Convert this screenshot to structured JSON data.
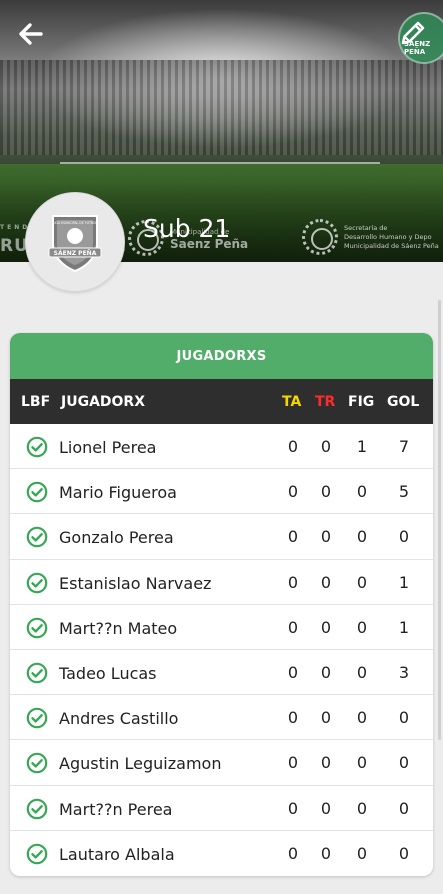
{
  "header": {
    "back_icon": "arrow-left-icon",
    "edit_icon": "pencil-icon",
    "team_name": "Sub 21",
    "banner_sponsors": {
      "left_small": "TENDE",
      "left_main": "RUNC CIPOL",
      "mid_line1": "Municipalidad de",
      "mid_line2": "Saenz Peña",
      "right_line1": "Secretaría de",
      "right_line2": "Desarrollo Humano y Depo",
      "right_line3": "Municipalidad de Sáenz Peña"
    },
    "corner_logo_text": "SAENZ PEÑA",
    "avatar_text_top": "LIGA MUNICIPAL DE FUTBOL",
    "avatar_text": "SÁENZ PEÑA"
  },
  "card": {
    "title": "JUGADORXS",
    "columns": {
      "lbf": "LBF",
      "player": "JUGADORX",
      "ta": "TA",
      "tr": "TR",
      "fig": "FIG",
      "gol": "GOL"
    },
    "rows": [
      {
        "name": "Lionel Perea",
        "ta": "0",
        "tr": "0",
        "fig": "1",
        "gol": "7"
      },
      {
        "name": "Mario Figueroa",
        "ta": "0",
        "tr": "0",
        "fig": "0",
        "gol": "5"
      },
      {
        "name": "Gonzalo Perea",
        "ta": "0",
        "tr": "0",
        "fig": "0",
        "gol": "0"
      },
      {
        "name": "Estanislao Narvaez",
        "ta": "0",
        "tr": "0",
        "fig": "0",
        "gol": "1"
      },
      {
        "name": "Mart??n Mateo",
        "ta": "0",
        "tr": "0",
        "fig": "0",
        "gol": "1"
      },
      {
        "name": "Tadeo Lucas",
        "ta": "0",
        "tr": "0",
        "fig": "0",
        "gol": "3"
      },
      {
        "name": "Andres Castillo",
        "ta": "0",
        "tr": "0",
        "fig": "0",
        "gol": "0"
      },
      {
        "name": "Agustin Leguizamon",
        "ta": "0",
        "tr": "0",
        "fig": "0",
        "gol": "0"
      },
      {
        "name": "Mart??n Perea",
        "ta": "0",
        "tr": "0",
        "fig": "0",
        "gol": "0"
      },
      {
        "name": "Lautaro Albala",
        "ta": "0",
        "tr": "0",
        "fig": "0",
        "gol": "0"
      }
    ]
  },
  "colors": {
    "accent_green": "#53ad6a",
    "table_header": "#2e2e2e",
    "ta_yellow": "#f4d700",
    "tr_red": "#ff2a2a",
    "check_green": "#34a853"
  }
}
